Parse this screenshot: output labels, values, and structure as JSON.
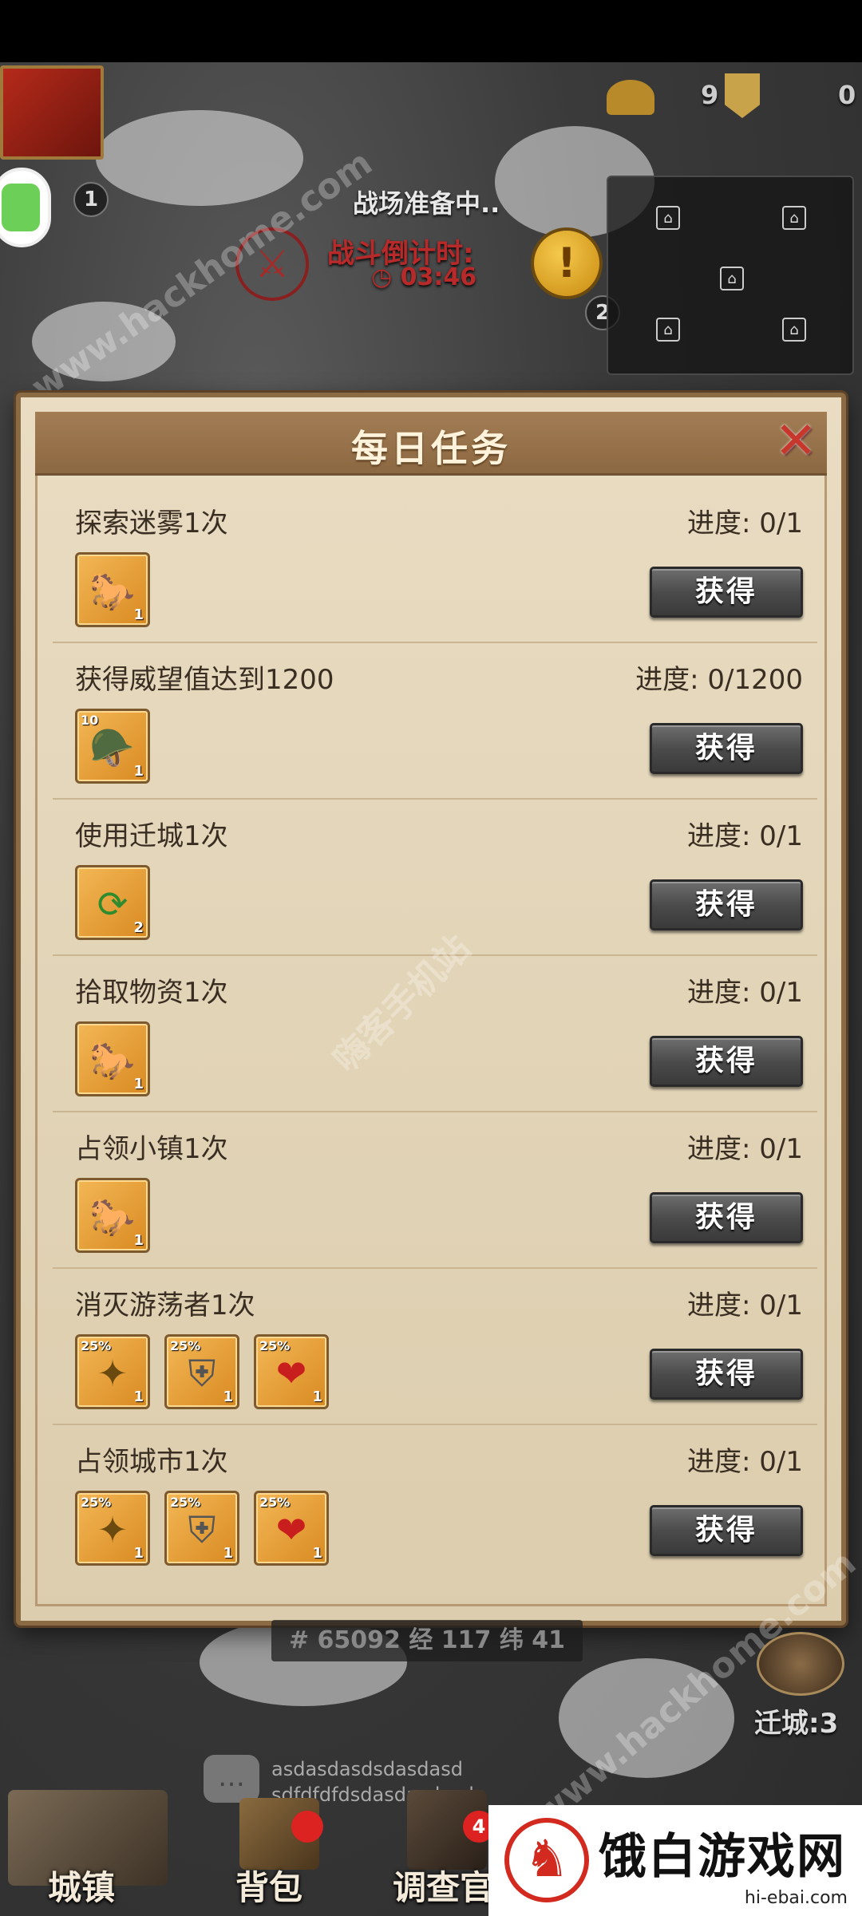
{
  "hud": {
    "status": "战场准备中..",
    "countdown_label": "战斗倒计时:",
    "countdown_time": "03:46",
    "player_level": "1",
    "alliance_level": "2",
    "members_count": "9",
    "top_right_value": "0"
  },
  "dialog": {
    "title": "每日任务",
    "claim_label": "获得",
    "progress_prefix": "进度:",
    "tasks": [
      {
        "name": "探索迷雾1次",
        "progress": "0/1",
        "rewards": [
          {
            "icon": "horse-rider-icon",
            "qty": "1",
            "tag": ""
          }
        ]
      },
      {
        "name": "获得威望值达到1200",
        "progress": "0/1200",
        "rewards": [
          {
            "icon": "soldier-portrait-icon",
            "qty": "1",
            "tag": "10"
          }
        ]
      },
      {
        "name": "使用迁城1次",
        "progress": "0/1",
        "rewards": [
          {
            "icon": "relocate-city-icon",
            "qty": "2",
            "tag": ""
          }
        ]
      },
      {
        "name": "拾取物资1次",
        "progress": "0/1",
        "rewards": [
          {
            "icon": "horse-rider-icon",
            "qty": "1",
            "tag": ""
          }
        ]
      },
      {
        "name": "占领小镇1次",
        "progress": "0/1",
        "rewards": [
          {
            "icon": "horse-rider-icon",
            "qty": "1",
            "tag": ""
          }
        ]
      },
      {
        "name": "消灭游荡者1次",
        "progress": "0/1",
        "rewards": [
          {
            "icon": "attack-boost-icon",
            "qty": "1",
            "tag": "25%"
          },
          {
            "icon": "defense-shield-icon",
            "qty": "1",
            "tag": "25%"
          },
          {
            "icon": "health-heart-icon",
            "qty": "1",
            "tag": "25%"
          }
        ]
      },
      {
        "name": "占领城市1次",
        "progress": "0/1",
        "rewards": [
          {
            "icon": "attack-boost-icon",
            "qty": "1",
            "tag": "25%"
          },
          {
            "icon": "defense-shield-icon",
            "qty": "1",
            "tag": "25%"
          },
          {
            "icon": "health-heart-icon",
            "qty": "1",
            "tag": "25%"
          }
        ]
      }
    ]
  },
  "map": {
    "coordinates": "# 65092 经 117 纬 41",
    "move_city": "迁城:3"
  },
  "chat": {
    "line1": "asdasdasdsdasdasd",
    "line2": "sdfdfdfdsdasdasdasd"
  },
  "nav": {
    "town": "城镇",
    "bag": "背包",
    "officer": "调查官",
    "officer_badge": "4"
  },
  "watermarks": {
    "top": "www.hackhome.com",
    "middle": "嗨客手机站",
    "bottom": "www.hackhome.com"
  },
  "site_logo": {
    "brand": "饿白游戏网",
    "url": "hi-ebai.com"
  },
  "colors": {
    "parchment": "#e2d4b7",
    "header": "#8c6842",
    "button": "#4b4b4b",
    "close": "#c8372c",
    "reward_bg": "#d98a22"
  }
}
